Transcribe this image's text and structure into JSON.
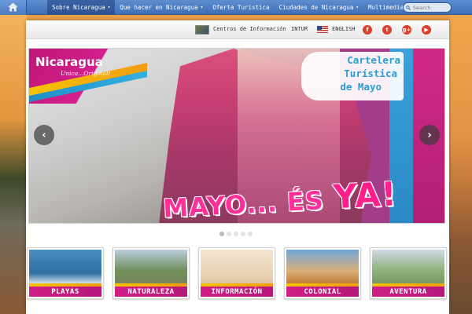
{
  "nav": {
    "home_icon": "home-icon",
    "items": [
      {
        "label": "Sobre Nicaragua",
        "has_caret": true
      },
      {
        "label": "Que hacer en Nicaragua",
        "has_caret": true
      },
      {
        "label": "Oferta Turistica",
        "has_caret": false
      },
      {
        "label": "Ciudades de Nicaragua",
        "has_caret": true
      },
      {
        "label": "Multimedia",
        "has_caret": true
      }
    ],
    "caret": "▾",
    "search_placeholder": "Search"
  },
  "subbar": {
    "centros_label": "Centros de Información",
    "intur_label": "INTUR",
    "english_label": "ENGLISH",
    "social": [
      {
        "icon": "facebook-icon",
        "glyph": "f"
      },
      {
        "icon": "twitter-icon",
        "glyph": "t"
      },
      {
        "icon": "google-plus-icon",
        "glyph": "g+"
      },
      {
        "icon": "youtube-icon",
        "glyph": "▶"
      }
    ]
  },
  "hero": {
    "logo_text": "Nicaragua",
    "logo_tagline": "Unica...Original!",
    "promo_line1": "Cartelera",
    "promo_line2": "Turística",
    "promo_line3": "de Mayo",
    "headline_main": "MAYO... ÉS ",
    "headline_accent": "YA!",
    "prev_arrow": "‹",
    "next_arrow": "›",
    "slide_count": 5,
    "active_slide": 1
  },
  "tiles": [
    {
      "label": "PLAYAS"
    },
    {
      "label": "NATURALEZA"
    },
    {
      "label": "INFORMACIÓN"
    },
    {
      "label": "COLONIAL"
    },
    {
      "label": "AVENTURA"
    }
  ],
  "colors": {
    "nav_blue": "#3f6fb7",
    "brand_pink": "#d01e86",
    "brand_yellow": "#f5c300",
    "brand_cyan": "#2a9bd5",
    "social_red": "#d9402b"
  }
}
